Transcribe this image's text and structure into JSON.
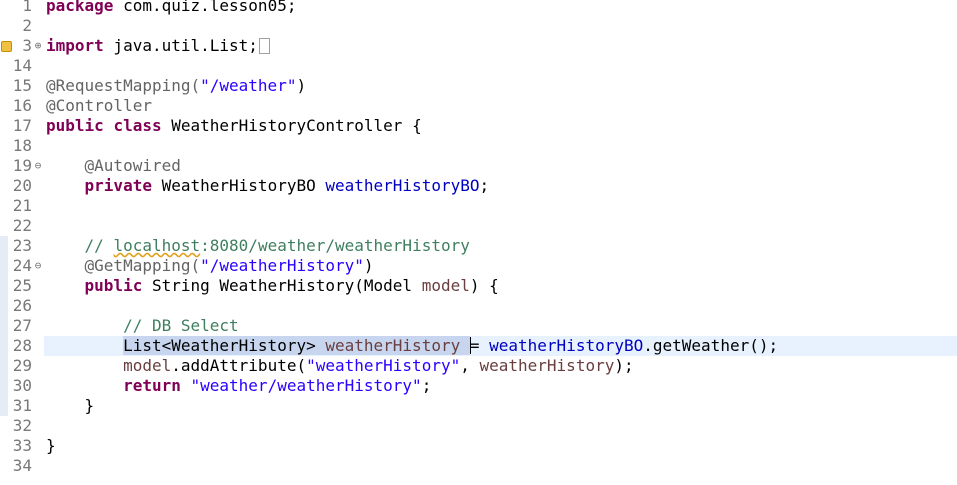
{
  "lines": [
    {
      "num": "1",
      "tokens": [
        {
          "t": "package",
          "c": "kw"
        },
        {
          "t": " com.quiz.lesson05;"
        }
      ]
    },
    {
      "num": "2",
      "tokens": []
    },
    {
      "num": "3",
      "fold": "plus",
      "warn": true,
      "tokens": [
        {
          "t": "import",
          "c": "kw"
        },
        {
          "t": " java.util.List;"
        },
        {
          "t": "",
          "c": "folded-box"
        }
      ]
    },
    {
      "num": "14",
      "tokens": []
    },
    {
      "num": "15",
      "tokens": [
        {
          "t": "@RequestMapping(",
          "c": "ann"
        },
        {
          "t": "\"/weather\"",
          "c": "str"
        },
        {
          "t": ")"
        }
      ]
    },
    {
      "num": "16",
      "tokens": [
        {
          "t": "@Controller",
          "c": "ann"
        }
      ]
    },
    {
      "num": "17",
      "tokens": [
        {
          "t": "public",
          "c": "kw"
        },
        {
          "t": " "
        },
        {
          "t": "class",
          "c": "kw"
        },
        {
          "t": " WeatherHistoryController {"
        }
      ]
    },
    {
      "num": "18",
      "tokens": []
    },
    {
      "num": "19",
      "fold": "minus",
      "tokens": [
        {
          "t": "    "
        },
        {
          "t": "@Autowired",
          "c": "ann"
        }
      ]
    },
    {
      "num": "20",
      "tokens": [
        {
          "t": "    "
        },
        {
          "t": "private",
          "c": "kw"
        },
        {
          "t": " WeatherHistoryBO "
        },
        {
          "t": "weatherHistoryBO",
          "c": "fld"
        },
        {
          "t": ";"
        }
      ]
    },
    {
      "num": "21",
      "tokens": []
    },
    {
      "num": "22",
      "tokens": []
    },
    {
      "num": "23",
      "ruler": true,
      "tokens": [
        {
          "t": "    "
        },
        {
          "t": "// ",
          "c": "cmt"
        },
        {
          "t": "localhost",
          "c": "cmt squig"
        },
        {
          "t": ":8080/weather/weatherHistory",
          "c": "cmt"
        }
      ]
    },
    {
      "num": "24",
      "fold": "minus",
      "ruler": true,
      "tokens": [
        {
          "t": "    "
        },
        {
          "t": "@GetMapping(",
          "c": "ann"
        },
        {
          "t": "\"/weatherHistory\"",
          "c": "str"
        },
        {
          "t": ")"
        }
      ]
    },
    {
      "num": "25",
      "ruler": true,
      "tokens": [
        {
          "t": "    "
        },
        {
          "t": "public",
          "c": "kw"
        },
        {
          "t": " String WeatherHistory(Model "
        },
        {
          "t": "model",
          "c": "param"
        },
        {
          "t": ") {"
        }
      ]
    },
    {
      "num": "26",
      "ruler": true,
      "tokens": []
    },
    {
      "num": "27",
      "ruler": true,
      "tokens": [
        {
          "t": "        "
        },
        {
          "t": "// DB Select",
          "c": "cmt"
        }
      ]
    },
    {
      "num": "28",
      "ruler": true,
      "current": true,
      "tokens": [
        {
          "t": "        "
        },
        {
          "t": "List<WeatherHistory> ",
          "c": "sel"
        },
        {
          "t": "weatherHistory",
          "c": "local sel"
        },
        {
          "t": " ",
          "c": "sel"
        },
        {
          "t": "",
          "c": "caret"
        },
        {
          "t": "= "
        },
        {
          "t": "weatherHistoryBO",
          "c": "fld"
        },
        {
          "t": ".getWeather();"
        }
      ]
    },
    {
      "num": "29",
      "ruler": true,
      "tokens": [
        {
          "t": "        "
        },
        {
          "t": "model",
          "c": "param"
        },
        {
          "t": ".addAttribute("
        },
        {
          "t": "\"weatherHistory\"",
          "c": "str"
        },
        {
          "t": ", "
        },
        {
          "t": "weatherHistory",
          "c": "local"
        },
        {
          "t": ");"
        }
      ]
    },
    {
      "num": "30",
      "ruler": true,
      "tokens": [
        {
          "t": "        "
        },
        {
          "t": "return",
          "c": "kw"
        },
        {
          "t": " "
        },
        {
          "t": "\"weather/weatherHistory\"",
          "c": "str"
        },
        {
          "t": ";"
        }
      ]
    },
    {
      "num": "31",
      "ruler": true,
      "tokens": [
        {
          "t": "    }"
        }
      ]
    },
    {
      "num": "32",
      "tokens": []
    },
    {
      "num": "33",
      "tokens": [
        {
          "t": "}"
        }
      ]
    },
    {
      "num": "34",
      "tokens": []
    }
  ]
}
